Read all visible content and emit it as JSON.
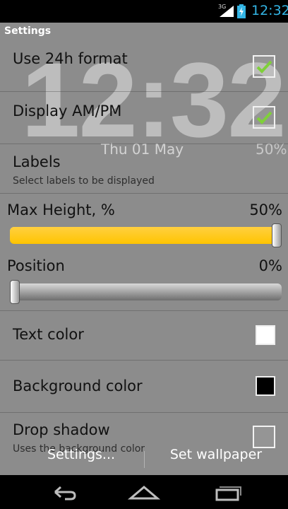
{
  "status_bar": {
    "network": "3G",
    "time": "12:32",
    "accent_color": "#33b5e5"
  },
  "clock_preview": {
    "time": "12:32",
    "date": "Thu 01 May",
    "percent": "50%"
  },
  "app_bar": {
    "title": "Settings"
  },
  "settings": {
    "use_24h": {
      "label": "Use 24h format",
      "checked": true
    },
    "display_ampm": {
      "label": "Display AM/PM",
      "checked": true
    },
    "labels": {
      "label": "Labels",
      "summary": "Select labels to be displayed"
    },
    "max_height": {
      "label": "Max Height, %",
      "value_text": "50%",
      "value": 100,
      "fill_color": "#ffc400"
    },
    "position": {
      "label": "Position",
      "value_text": "0%",
      "value": 0
    },
    "text_color": {
      "label": "Text color",
      "swatch": "#ffffff"
    },
    "background_color": {
      "label": "Background color",
      "swatch": "#000000"
    },
    "drop_shadow": {
      "label": "Drop shadow",
      "summary": "Uses the background color",
      "checked": false
    }
  },
  "bottom_actions": {
    "settings_label": "Settings...",
    "wallpaper_label": "Set wallpaper"
  },
  "nav_bar": {
    "back_icon": "back-icon",
    "home_icon": "home-icon",
    "recents_icon": "recents-icon"
  }
}
